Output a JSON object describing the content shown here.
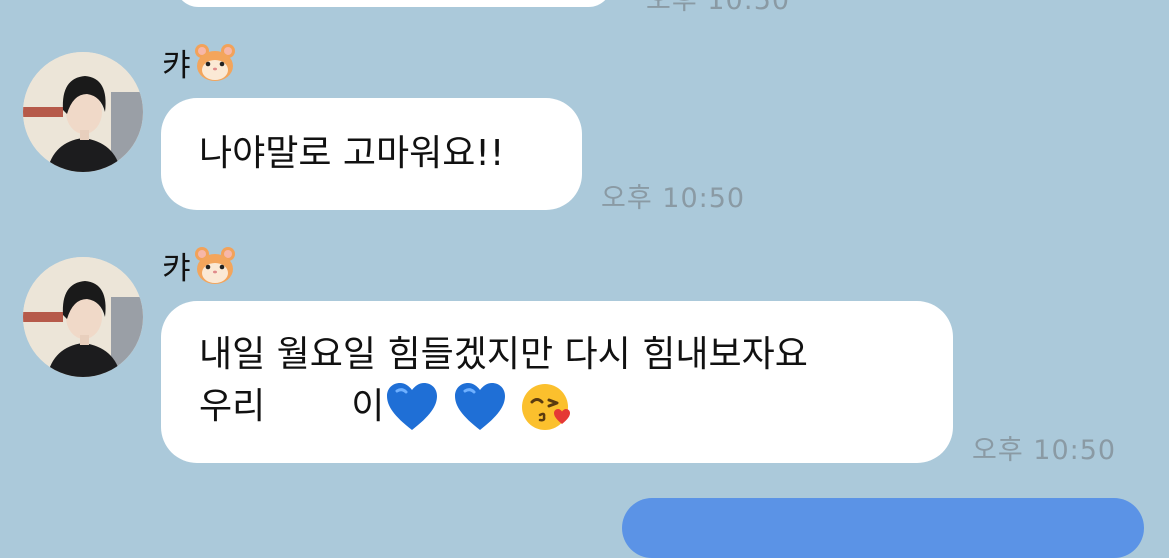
{
  "chat": {
    "sender_name": "캬",
    "messages": [
      {
        "text": "나야말로 고마워요!!",
        "time": "오후 10:50"
      },
      {
        "line1": "내일 월요일 힘들겠지만 다시 힘내보자요",
        "line2_prefix": "우리",
        "line2_suffix": "이",
        "time": "오후 10:50"
      }
    ],
    "previous_time_partial": "오후 10:50"
  },
  "icons": {
    "name_emoji": "hamster-face-icon",
    "hearts": [
      "blue-heart-icon",
      "blue-heart-icon"
    ],
    "kiss": "face-blowing-kiss-icon"
  },
  "colors": {
    "background": "#abc9da",
    "incoming_bubble": "#ffffff",
    "outgoing_bubble": "#5b93e6",
    "timestamp": "#8a9aa4"
  }
}
